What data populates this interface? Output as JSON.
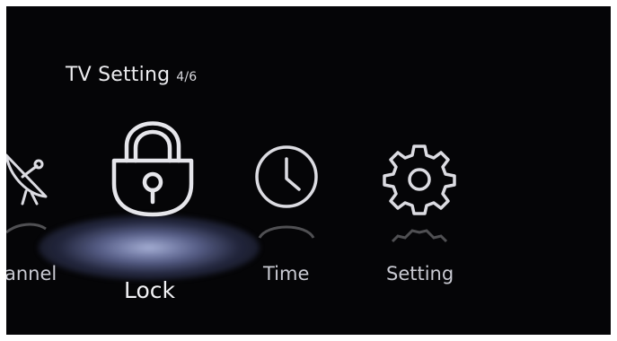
{
  "header": {
    "title": "TV Setting",
    "counter": "4/6"
  },
  "menu": {
    "items": [
      {
        "label": "annel",
        "icon": "satellite-dish-icon",
        "selected": false
      },
      {
        "label": "Lock",
        "icon": "lock-icon",
        "selected": true
      },
      {
        "label": "Time",
        "icon": "clock-icon",
        "selected": false
      },
      {
        "label": "Setting",
        "icon": "gear-icon",
        "selected": false
      }
    ]
  },
  "colors": {
    "background": "#050507",
    "icon_stroke": "#dcdce2",
    "selection_glow": "#8f98c8",
    "label_text": "#c9cad2"
  }
}
